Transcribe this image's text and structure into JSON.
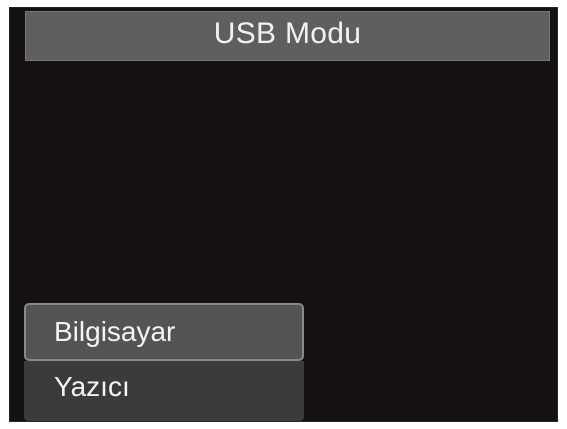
{
  "title": "USB Modu",
  "menu": {
    "items": [
      {
        "label": "Bilgisayar",
        "selected": true
      },
      {
        "label": "Yazıcı",
        "selected": false
      }
    ]
  },
  "colors": {
    "screen_background": "#151110",
    "title_bar": "#5f5f5f",
    "selected_item": "#545454",
    "item": "#3b3b3b",
    "text": "#f4f4f4"
  }
}
